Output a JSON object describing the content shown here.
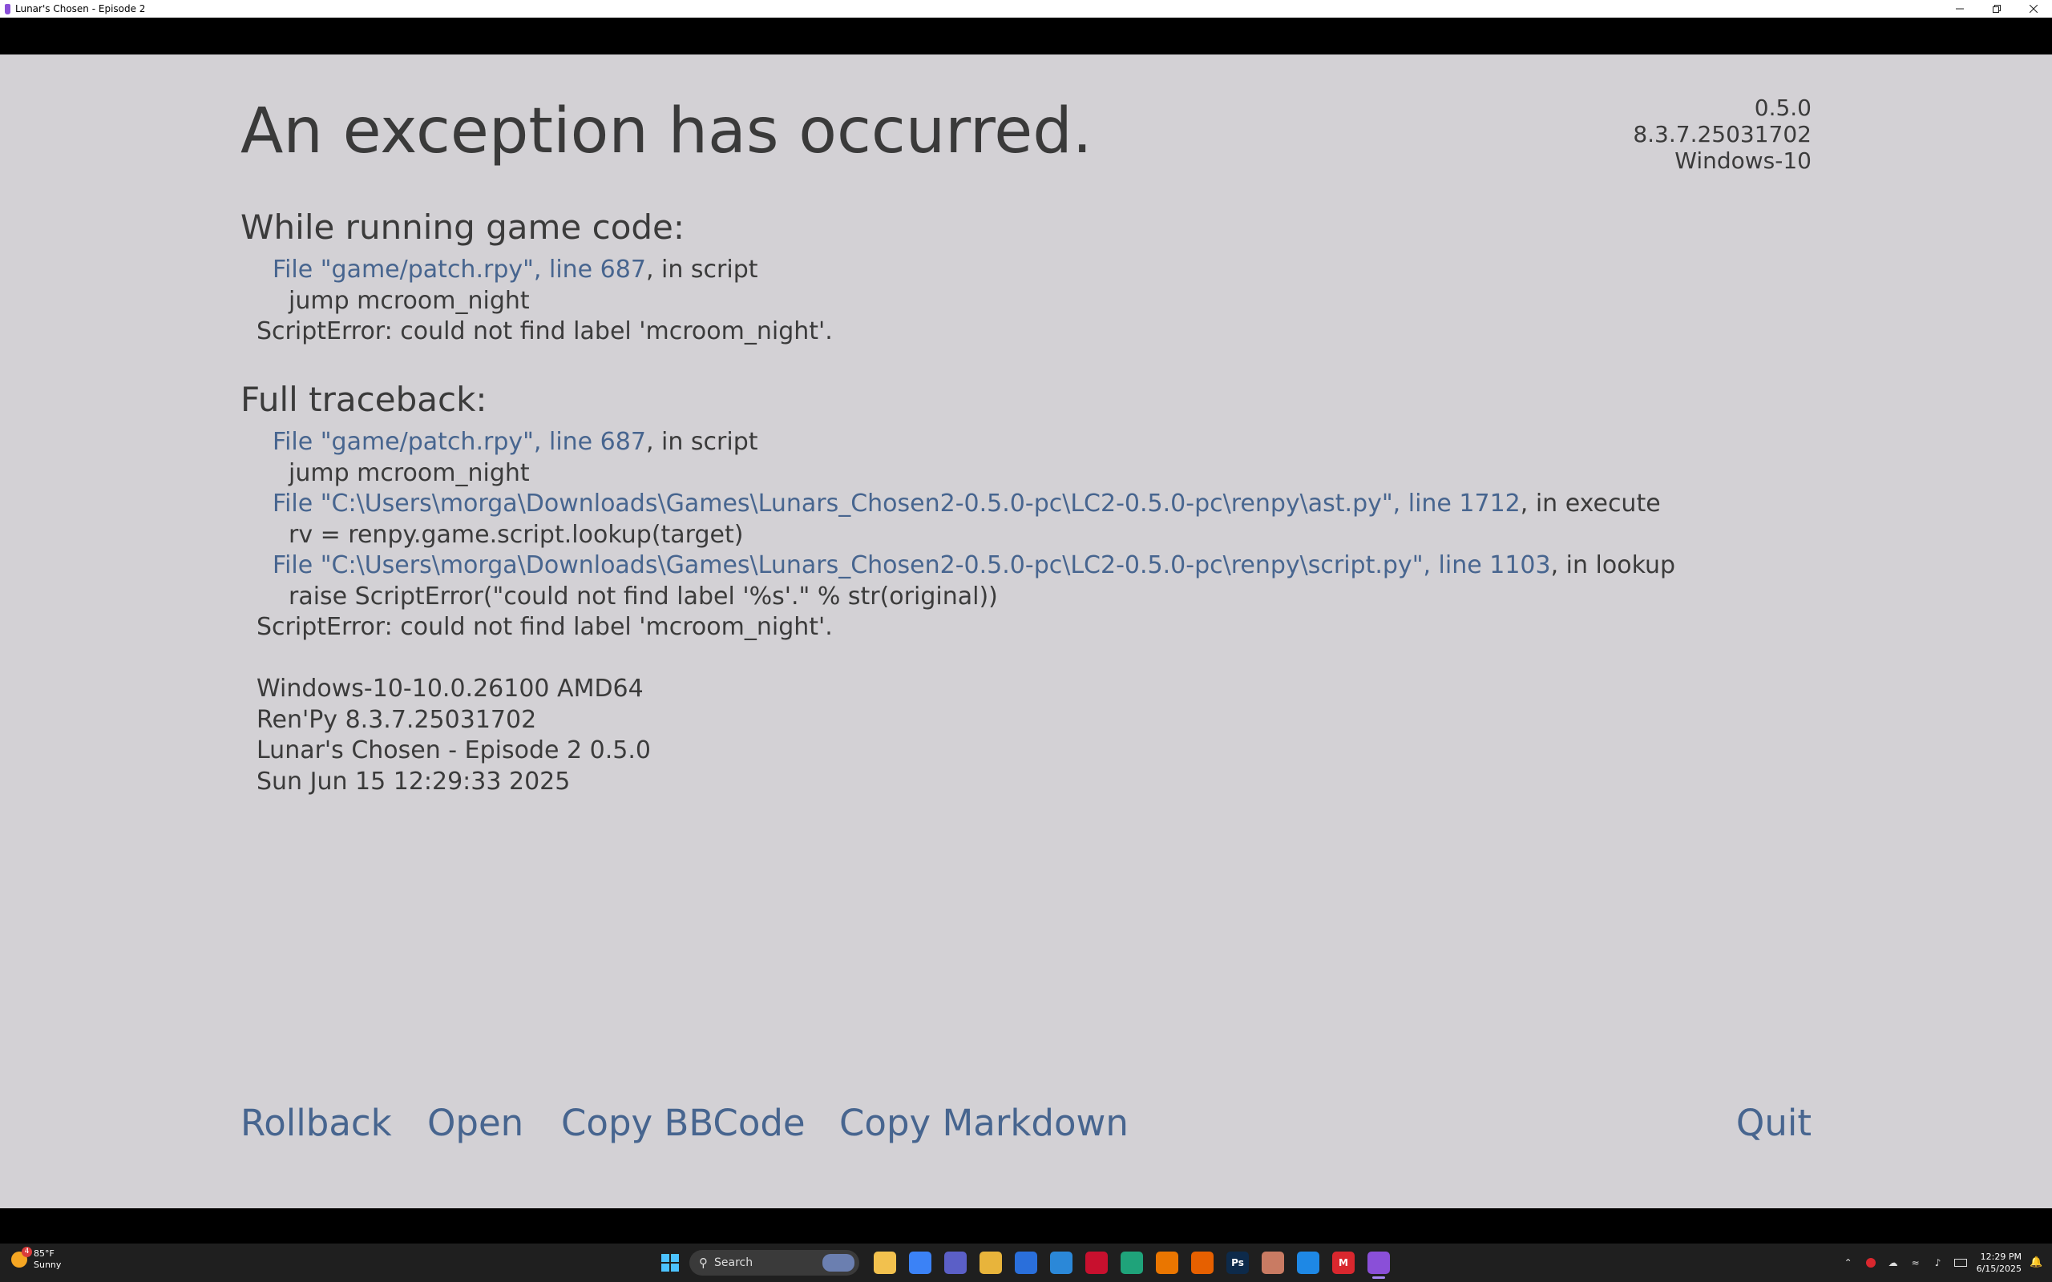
{
  "window": {
    "title": "Lunar's Chosen - Episode 2"
  },
  "error": {
    "heading": "An exception has occurred.",
    "version_info": [
      "0.5.0",
      "8.3.7.25031702",
      "Windows-10"
    ],
    "while_running": {
      "title": "While running game code:",
      "lines": [
        {
          "kind": "file",
          "link": "File \"game/patch.rpy\", line 687",
          "suffix": ", in script"
        },
        {
          "kind": "code",
          "text": "jump mcroom_night"
        },
        {
          "kind": "err",
          "text": "ScriptError: could not find label 'mcroom_night'."
        }
      ]
    },
    "full_traceback": {
      "title": "Full traceback:",
      "lines": [
        {
          "kind": "file",
          "link": "File \"game/patch.rpy\", line 687",
          "suffix": ", in script"
        },
        {
          "kind": "code",
          "text": "jump mcroom_night"
        },
        {
          "kind": "file",
          "link": "File \"C:\\Users\\morga\\Downloads\\Games\\Lunars_Chosen2-0.5.0-pc\\LC2-0.5.0-pc\\renpy\\ast.py\", line 1712",
          "suffix": ", in execute"
        },
        {
          "kind": "code",
          "text": "rv = renpy.game.script.lookup(target)"
        },
        {
          "kind": "file",
          "link": "File \"C:\\Users\\morga\\Downloads\\Games\\Lunars_Chosen2-0.5.0-pc\\LC2-0.5.0-pc\\renpy\\script.py\", line 1103",
          "suffix": ", in lookup"
        },
        {
          "kind": "code",
          "text": "raise ScriptError(\"could not find label '%s'.\" % str(original))"
        },
        {
          "kind": "err",
          "text": "ScriptError: could not find label 'mcroom_night'."
        },
        {
          "kind": "blank",
          "text": ""
        },
        {
          "kind": "err",
          "text": "Windows-10-10.0.26100 AMD64"
        },
        {
          "kind": "err",
          "text": "Ren'Py 8.3.7.25031702"
        },
        {
          "kind": "err",
          "text": "Lunar's Chosen - Episode 2 0.5.0"
        },
        {
          "kind": "err",
          "text": "Sun Jun 15 12:29:33 2025"
        }
      ]
    },
    "actions": {
      "rollback": "Rollback",
      "open": "Open",
      "copy_bbcode": "Copy BBCode",
      "copy_markdown": "Copy Markdown",
      "quit": "Quit"
    },
    "colors": {
      "background": "#d3d1d5",
      "text": "#3b3b3b",
      "link": "#47658f"
    }
  },
  "taskbar": {
    "weather": {
      "temp": "85°F",
      "condition": "Sunny",
      "badge": "4"
    },
    "search_placeholder": "Search",
    "apps": [
      {
        "name": "file-explorer-icon",
        "color": "#f2c14e",
        "glyph": ""
      },
      {
        "name": "copilot-icon",
        "color": "#3b82f6",
        "glyph": ""
      },
      {
        "name": "teams-icon",
        "color": "#5b5fc7",
        "glyph": ""
      },
      {
        "name": "folder-icon",
        "color": "#e8b43b",
        "glyph": ""
      },
      {
        "name": "store-icon",
        "color": "#2a6fdb",
        "glyph": ""
      },
      {
        "name": "pen-app-icon",
        "color": "#2b88d8",
        "glyph": ""
      },
      {
        "name": "mcafee-icon",
        "color": "#c8102e",
        "glyph": ""
      },
      {
        "name": "game-app-icon",
        "color": "#1fa37a",
        "glyph": ""
      },
      {
        "name": "blender-icon",
        "color": "#ea7600",
        "glyph": ""
      },
      {
        "name": "firefox-icon",
        "color": "#e66000",
        "glyph": ""
      },
      {
        "name": "photoshop-icon",
        "color": "#0d2a4a",
        "glyph": "Ps"
      },
      {
        "name": "character-app-icon",
        "color": "#c97b63",
        "glyph": ""
      },
      {
        "name": "vscode-icon",
        "color": "#1e88e5",
        "glyph": ""
      },
      {
        "name": "mega-icon",
        "color": "#d9272e",
        "glyph": "M"
      },
      {
        "name": "lunars-chosen-icon",
        "color": "#8a4fd8",
        "glyph": "",
        "active": true
      }
    ],
    "clock": {
      "time": "12:29 PM",
      "date": "6/15/2025"
    }
  }
}
